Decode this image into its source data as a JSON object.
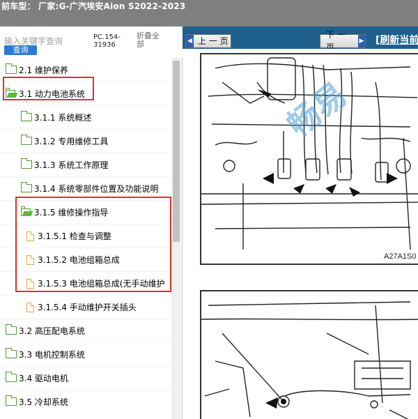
{
  "window": {
    "title": "前车型：  厂家:G-广汽埃安Aion S2022-2023"
  },
  "search": {
    "placeholder": "输入关键字查询",
    "button_label": "查询",
    "pc_code": "PC.154-31936",
    "collapse_all": "折叠全部"
  },
  "tree": [
    {
      "label": "2.1 维护保养",
      "icon": "folder-closed-icon"
    },
    {
      "label": "3.1 动力电池系统",
      "icon": "folder-open-icon"
    },
    {
      "label": "3.1.1 系统概述",
      "icon": "folder-closed-icon"
    },
    {
      "label": "3.1.2 专用维修工具",
      "icon": "folder-closed-icon"
    },
    {
      "label": "3.1.3 系统工作原理",
      "icon": "folder-closed-icon"
    },
    {
      "label": "3.1.4 系统零部件位置及功能说明",
      "icon": "folder-closed-icon"
    },
    {
      "label": "3.1.5 维修操作指导",
      "icon": "folder-open-icon"
    },
    {
      "label": "3.1.5.1 检查与调整",
      "icon": "document-icon"
    },
    {
      "label": "3.1.5.2 电池组箱总成",
      "icon": "document-icon"
    },
    {
      "label": "3.1.5.3 电池组箱总成(无手动维护",
      "icon": "document-icon"
    },
    {
      "label": "3.1.5.4 手动维护开关插头",
      "icon": "document-icon"
    },
    {
      "label": "3.2 高压配电系统",
      "icon": "folder-closed-icon"
    },
    {
      "label": "3.3 电机控制系统",
      "icon": "folder-closed-icon"
    },
    {
      "label": "3.4 驱动电机",
      "icon": "folder-closed-icon"
    },
    {
      "label": "3.5 冷却系统",
      "icon": "folder-closed-icon"
    }
  ],
  "nav": {
    "prev_label": "上 一 页",
    "next_label": "下 一 页",
    "refresh_label": "[刷新当前"
  },
  "figure": {
    "code": "A27A1S0",
    "watermark": "畅易"
  },
  "colors": {
    "titlebar": "#7f7f7f",
    "navbar": "#1e5f8c",
    "highlight": "#e0302a",
    "search_button": "#2f79d6"
  }
}
